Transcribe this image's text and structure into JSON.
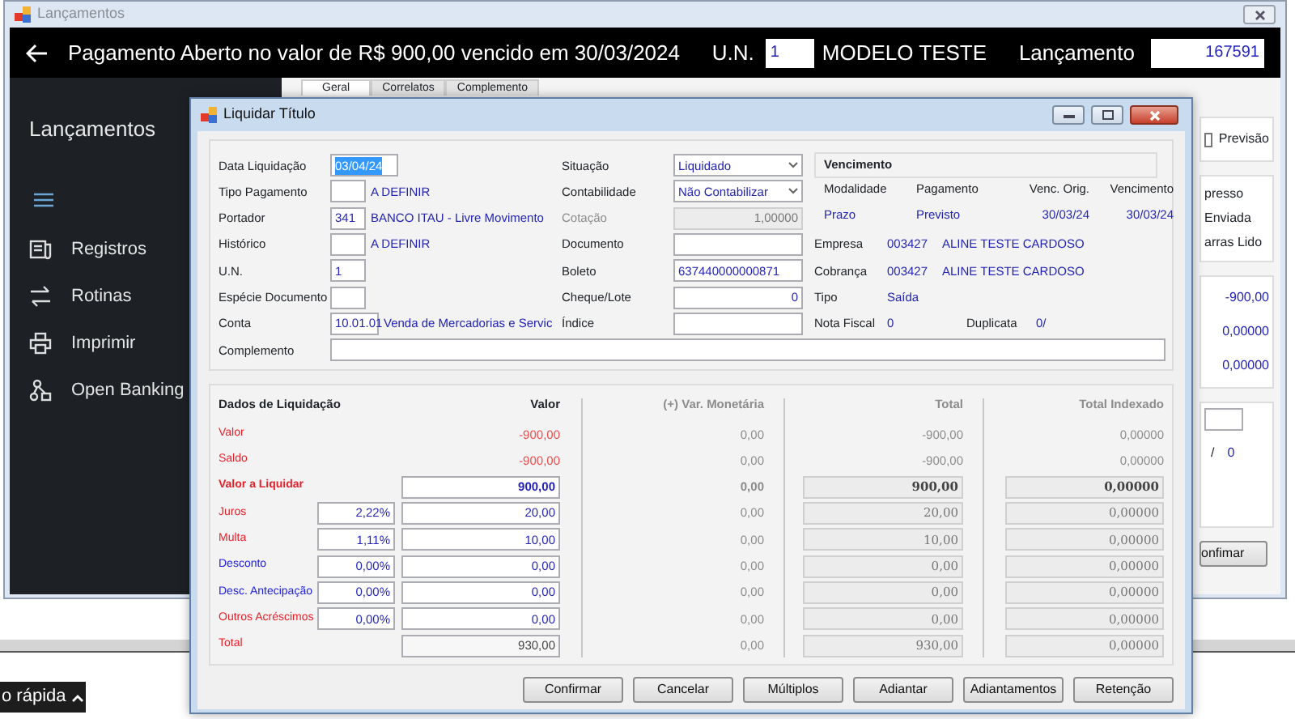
{
  "main_window": {
    "title": "Lançamentos"
  },
  "header": {
    "title": "Pagamento Aberto no valor de R$ 900,00 vencido em 30/03/2024",
    "un_label": "U.N.",
    "un_value": "1",
    "un_name": "MODELO TESTE",
    "entry_label": "Lançamento",
    "entry_value": "167591"
  },
  "sidebar": {
    "title": "Lançamentos",
    "items": [
      {
        "label": "Registros"
      },
      {
        "label": "Rotinas"
      },
      {
        "label": "Imprimir"
      },
      {
        "label": "Open Banking"
      }
    ]
  },
  "tabs": [
    {
      "label": "Geral",
      "selected": true
    },
    {
      "label": "Correlatos",
      "selected": false
    },
    {
      "label": "Complemento",
      "selected": false
    }
  ],
  "right_panel": {
    "forecast": {
      "label": "Previsão",
      "checked": false
    },
    "flags": [
      "presso",
      "Enviada",
      "arras Lido"
    ],
    "values": [
      "-900,00",
      "0,00000",
      "0,00000"
    ],
    "ratio": {
      "separator": "/",
      "value": "0"
    },
    "button": "onfimar"
  },
  "quick_tab": {
    "label": "o rápida"
  },
  "dialog": {
    "title": "Liquidar Título",
    "left_fields": [
      {
        "label": "Data Liquidação",
        "value": "03/04/24",
        "kind": "date",
        "text_selected": true
      },
      {
        "label": "Tipo Pagamento",
        "kind": "code",
        "description": "A DEFINIR"
      },
      {
        "label": "Portador",
        "value": "341",
        "kind": "code",
        "description": "BANCO ITAU - Livre Movimento"
      },
      {
        "label": "Histórico",
        "kind": "code",
        "description": "A DEFINIR"
      },
      {
        "label": "U.N.",
        "value": "1",
        "kind": "code"
      },
      {
        "label": "Espécie Documento",
        "kind": "code"
      },
      {
        "label": "Conta",
        "value": "10.01.01",
        "kind": "account",
        "description": "Venda de Mercadorias e Servic"
      }
    ],
    "right_fields": [
      {
        "label": "Situação",
        "value": "Liquidado",
        "kind": "select",
        "disabled": false
      },
      {
        "label": "Contabilidade",
        "value": "Não Contabilizar",
        "kind": "select",
        "disabled": false
      },
      {
        "label": "Cotação",
        "value": "1,00000",
        "kind": "number",
        "disabled": true
      },
      {
        "label": "Documento",
        "kind": "text",
        "disabled": false
      },
      {
        "label": "Boleto",
        "value": "637440000000871",
        "kind": "text",
        "disabled": false
      },
      {
        "label": "Cheque/Lote",
        "value": "0",
        "kind": "number",
        "disabled": false
      },
      {
        "label": "Índice",
        "kind": "text",
        "disabled": false
      }
    ],
    "due": {
      "title": "Vencimento",
      "columns": [
        "Modalidade",
        "Pagamento",
        "Venc. Orig.",
        "Vencimento"
      ],
      "values": [
        "Prazo",
        "Previsto",
        "30/03/24",
        "30/03/24"
      ]
    },
    "parties": [
      {
        "label": "Empresa",
        "code": "003427",
        "name": "ALINE TESTE CARDOSO"
      },
      {
        "label": "Cobrança",
        "code": "003427",
        "name": "ALINE TESTE CARDOSO"
      },
      {
        "label": "Tipo",
        "code": "Saída"
      }
    ],
    "invoice": {
      "label": "Nota Fiscal",
      "value": "0",
      "duplicate_label": "Duplicata",
      "duplicate_value": "0/"
    },
    "complement": {
      "label": "Complemento"
    },
    "settlement": {
      "columns": [
        "Dados de Liquidação",
        "Valor",
        "(+) Var. Monetária",
        "Total",
        "Total Indexado"
      ],
      "rows": [
        {
          "kind": "text",
          "label": "Valor",
          "color": "#e8202a",
          "value": "-900,00",
          "variation": "0,00",
          "total": "-900,00",
          "indexed": "0,00000"
        },
        {
          "kind": "text",
          "label": "Saldo",
          "color": "#e8202a",
          "value": "-900,00",
          "variation": "0,00",
          "total": "-900,00",
          "indexed": "0,00000"
        },
        {
          "kind": "highlight",
          "label": "Valor a Liquidar",
          "color": "#e8202a",
          "value": "900,00",
          "variation": "0,00",
          "total": "900,00",
          "indexed": "0,00000"
        },
        {
          "kind": "rate",
          "label": "Juros",
          "color": "#e8202a",
          "rate": "2,22%",
          "value": "20,00",
          "variation": "0,00",
          "total": "20,00",
          "indexed": "0,00000"
        },
        {
          "kind": "rate",
          "label": "Multa",
          "color": "#e8202a",
          "rate": "1,11%",
          "value": "10,00",
          "variation": "0,00",
          "total": "10,00",
          "indexed": "0,00000"
        },
        {
          "kind": "rate",
          "label": "Desconto",
          "color": "#2020e0",
          "rate": "0,00%",
          "value": "0,00",
          "variation": "0,00",
          "total": "0,00",
          "indexed": "0,00000"
        },
        {
          "kind": "rate",
          "label": "Desc. Antecipação",
          "color": "#2020e0",
          "rate": "0,00%",
          "value": "0,00",
          "variation": "0,00",
          "total": "0,00",
          "indexed": "0,00000"
        },
        {
          "kind": "rate",
          "label": "Outros Acréscimos",
          "color": "#e8202a",
          "rate": "0,00%",
          "value": "0,00",
          "variation": "0,00",
          "total": "0,00",
          "indexed": "0,00000"
        },
        {
          "kind": "total",
          "label": "Total",
          "color": "#e8202a",
          "value": "930,00",
          "variation": "0,00",
          "total": "930,00",
          "indexed": "0,00000"
        }
      ]
    },
    "buttons": [
      "Confirmar",
      "Cancelar",
      "Múltiplos",
      "Adiantar",
      "Adiantamentos",
      "Retenção"
    ]
  }
}
